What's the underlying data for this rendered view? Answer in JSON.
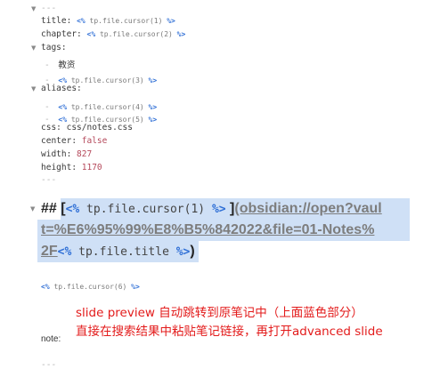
{
  "frontmatter": {
    "open_fence": "---",
    "close_fence": "---",
    "title": {
      "key": "title:",
      "tpl_open": "<%",
      "tpl_body": " tp.file.cursor(1) ",
      "tpl_close": "%>"
    },
    "chapter": {
      "key": "chapter:",
      "tpl_open": "<%",
      "tpl_body": " tp.file.cursor(2) ",
      "tpl_close": "%>"
    },
    "tags": {
      "key": "tags:",
      "item1_dash": "-",
      "item1": "教资",
      "item2_dash": "-",
      "item2_tpl_open": "<%",
      "item2_tpl_body": " tp.file.cursor(3) ",
      "item2_tpl_close": "%>"
    },
    "aliases": {
      "key": "aliases:",
      "item1_dash": "-",
      "item1_tpl_open": "<%",
      "item1_tpl_body": " tp.file.cursor(4) ",
      "item1_tpl_close": "%>",
      "item2_dash": "-",
      "item2_tpl_open": "<%",
      "item2_tpl_body": " tp.file.cursor(5) ",
      "item2_tpl_close": "%>"
    },
    "css": {
      "key": "css:",
      "value": " css/notes.css"
    },
    "center": {
      "key": "center:",
      "value": " false"
    },
    "width": {
      "key": "width:",
      "value": " 827"
    },
    "height": {
      "key": "height:",
      "value": " 1170"
    }
  },
  "heading": {
    "hashes": "##",
    "open_bracket": " [",
    "tpl1_open": "<%",
    "tpl1_body": " tp.file.cursor(1) ",
    "tpl1_close": "%>",
    "close_bracket": " ]",
    "link_line1": "(obsidian://open?vaul",
    "link_line2": "t=%E6%95%99%E8%B5%842022&file=01-Notes%",
    "link_line3": "2F",
    "tpl2_open": "<%",
    "tpl2_body": " tp.file.title ",
    "tpl2_close": "%>",
    "close_paren": ")"
  },
  "cursor6": {
    "tpl_open": "<%",
    "tpl_body": " tp.file.cursor(6) ",
    "tpl_close": "%>"
  },
  "annotation": {
    "line1": "slide preview 自动跳转到原笔记中（上面蓝色部分）",
    "line2": "直接在搜索结果中粘贴笔记链接，再打开advanced slide"
  },
  "note_label": "note:",
  "bottom_fence": "---",
  "icons": {
    "fold": "chevron-down-icon"
  },
  "colors": {
    "highlight": "#cfe0f6",
    "annotation": "#e31b1b",
    "template_delimiter": "#2f6fd6"
  }
}
